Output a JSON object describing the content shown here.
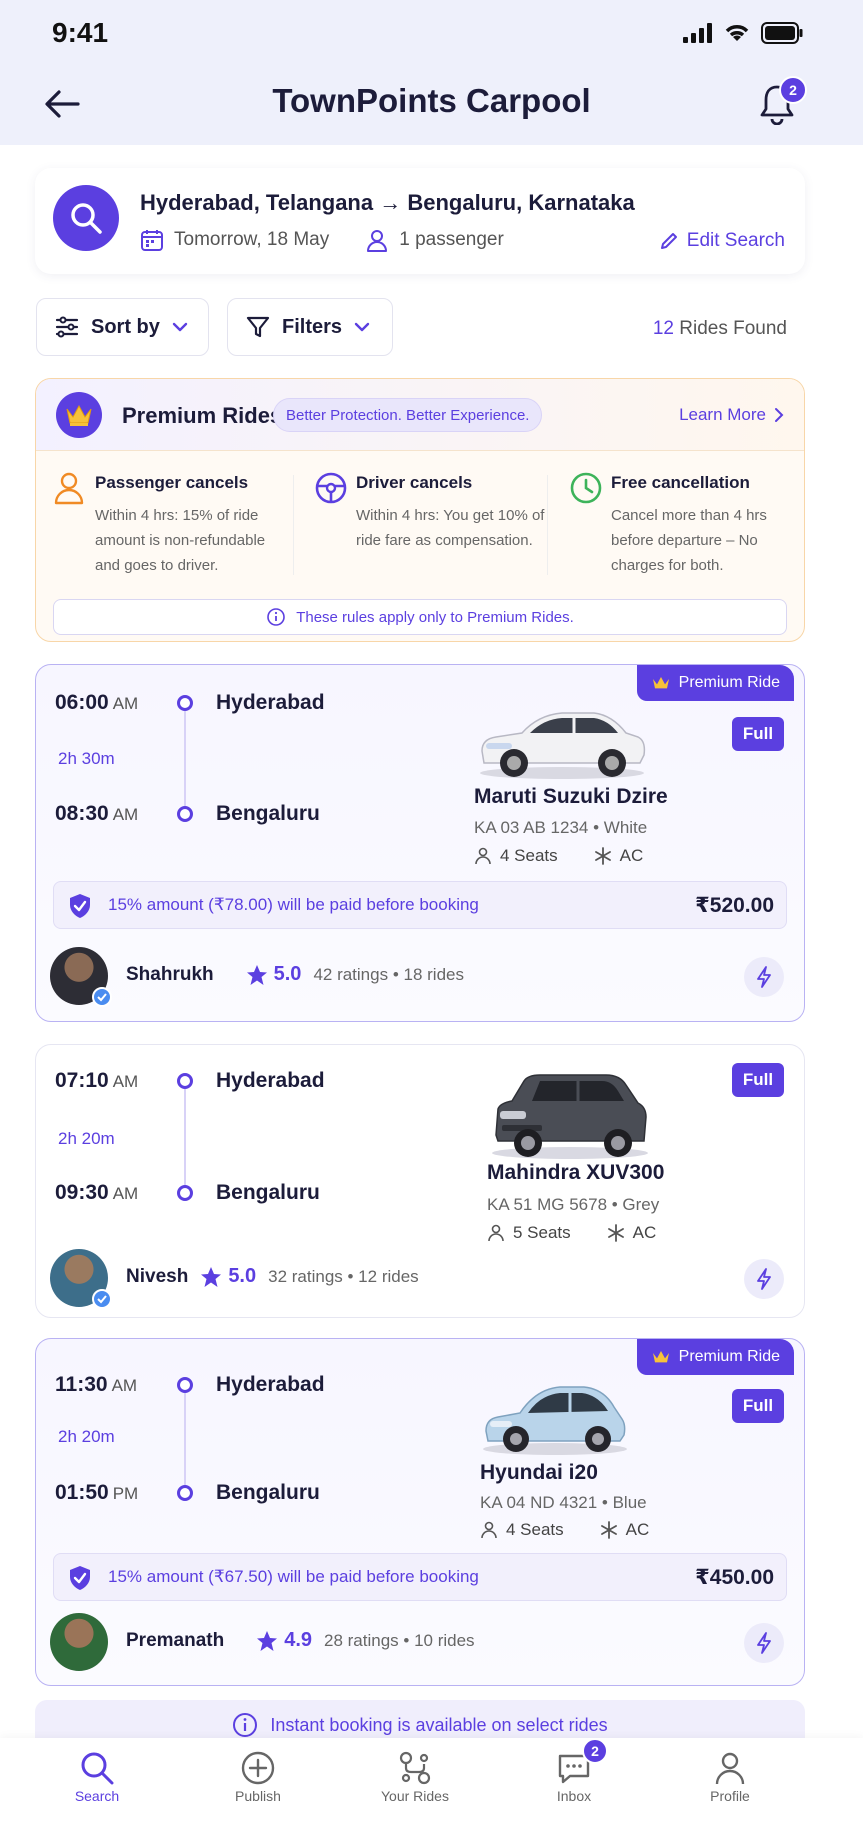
{
  "status": {
    "time": "9:41"
  },
  "header": {
    "title": "TownPoints Carpool",
    "notification_count": "2"
  },
  "search": {
    "route": "Hyderabad, Telangana → Bengaluru, Karnataka",
    "date": "Tomorrow, 18 May",
    "passengers": "1 passenger",
    "edit_label": "Edit Search"
  },
  "toolbar": {
    "sort_label": "Sort by",
    "filter_label": "Filters",
    "count_number": "12",
    "count_suffix": " Rides Found"
  },
  "premium": {
    "title": "Premium Rides",
    "tagline": "Better Protection. Better Experience.",
    "learn_more": "Learn More",
    "rules": [
      {
        "title": "Passenger cancels",
        "desc": "Within 4 hrs: 15% of ride amount is non-refundable and goes to driver."
      },
      {
        "title": "Driver cancels",
        "desc": "Within 4 hrs: You get 10% of ride fare as compensation."
      },
      {
        "title": "Free cancellation",
        "desc": "Cancel more than 4 hrs before departure – No charges for both."
      }
    ],
    "note": "These rules apply only to Premium Rides."
  },
  "rides": [
    {
      "premium_label": "Premium Ride",
      "status": "Full",
      "dep_time": "06:00",
      "dep_ampm": "AM",
      "duration": "2h 30m",
      "arr_time": "08:30",
      "arr_ampm": "AM",
      "from": "Hyderabad",
      "to": "Bengaluru",
      "car": "Maruti Suzuki Dzire",
      "plate": "KA 03 AB 1234  •  White",
      "seats": "4 Seats",
      "ac": "AC",
      "pay_note": "15% amount (₹78.00) will be paid before booking",
      "price": "₹520.00",
      "driver": "Shahrukh",
      "rating": "5.0",
      "rating_meta": "42 ratings  •  18 rides"
    },
    {
      "status": "Full",
      "dep_time": "07:10",
      "dep_ampm": "AM",
      "duration": "2h 20m",
      "arr_time": "09:30",
      "arr_ampm": "AM",
      "from": "Hyderabad",
      "to": "Bengaluru",
      "car": "Mahindra XUV300",
      "plate": "KA 51 MG 5678  •  Grey",
      "seats": "5 Seats",
      "ac": "AC",
      "driver": "Nivesh",
      "rating": "5.0",
      "rating_meta": "32 ratings  •  12 rides"
    },
    {
      "premium_label": "Premium Ride",
      "status": "Full",
      "dep_time": "11:30",
      "dep_ampm": "AM",
      "duration": "2h 20m",
      "arr_time": "01:50",
      "arr_ampm": "PM",
      "from": "Hyderabad",
      "to": "Bengaluru",
      "car": "Hyundai i20",
      "plate": "KA 04 ND 4321  •  Blue",
      "seats": "4 Seats",
      "ac": "AC",
      "pay_note": "15% amount (₹67.50) will be paid before booking",
      "price": "₹450.00",
      "driver": "Premanath",
      "rating": "4.9",
      "rating_meta": "28 ratings  •  10 rides"
    }
  ],
  "instant_note": "Instant booking is available on select rides",
  "tabs": [
    {
      "label": "Search",
      "icon": "search-icon"
    },
    {
      "label": "Publish",
      "icon": "plus-circle-icon"
    },
    {
      "label": "Your Rides",
      "icon": "route-icon"
    },
    {
      "label": "Inbox",
      "icon": "chat-icon",
      "badge": "2"
    },
    {
      "label": "Profile",
      "icon": "person-icon"
    }
  ],
  "colors": {
    "accent": "#5b3fe0",
    "header_bg": "#eef0fb",
    "premium_border": "#f8d6a8"
  }
}
